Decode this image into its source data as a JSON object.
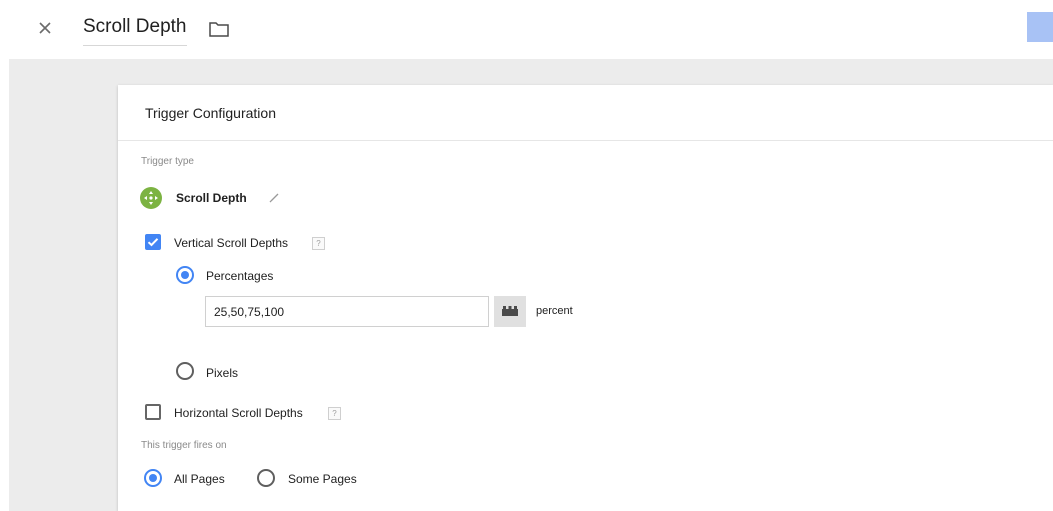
{
  "header": {
    "title": "Scroll Depth",
    "close_icon": "close-icon",
    "folder_icon": "folder-icon"
  },
  "colors": {
    "accent": "#4285f4",
    "trigger_icon": "#7cb342",
    "canvas": "#ececec",
    "save_button": "#a8c2f5"
  },
  "card": {
    "title": "Trigger Configuration",
    "trigger_type_label": "Trigger type",
    "trigger_type_name": "Scroll Depth",
    "trigger_type_icon": "move-arrows-icon",
    "vertical": {
      "label": "Vertical Scroll Depths",
      "checked": true,
      "help": "?",
      "options": [
        {
          "label": "Percentages",
          "selected": true
        },
        {
          "label": "Pixels",
          "selected": false
        }
      ],
      "input_value": "25,50,75,100",
      "unit": "percent"
    },
    "horizontal": {
      "label": "Horizontal Scroll Depths",
      "checked": false,
      "help": "?"
    },
    "fires_on_label": "This trigger fires on",
    "fires_on_options": [
      {
        "label": "All Pages",
        "selected": true
      },
      {
        "label": "Some Pages",
        "selected": false
      }
    ]
  }
}
